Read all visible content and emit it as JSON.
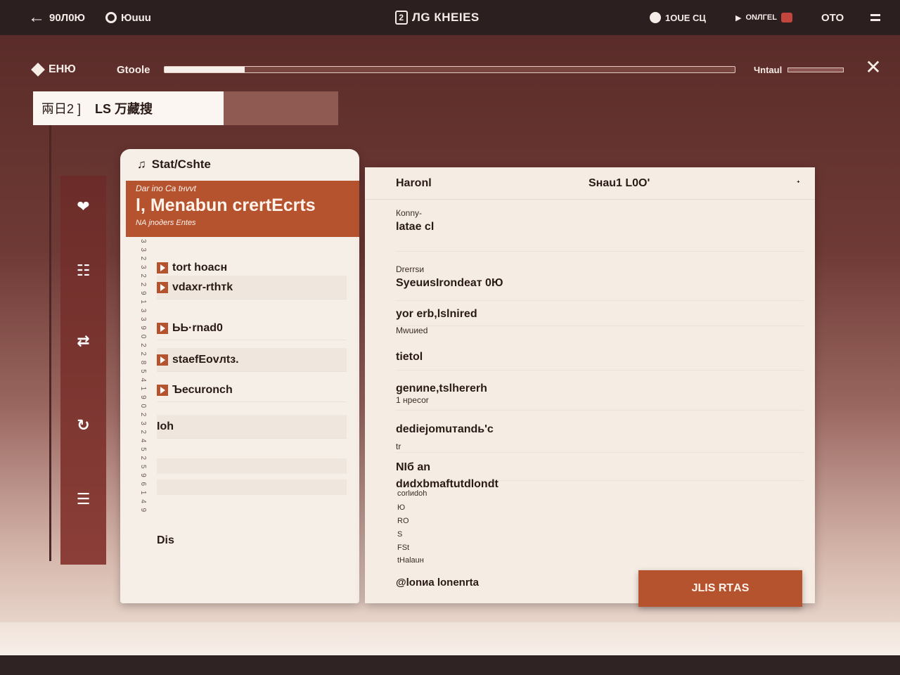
{
  "topbar": {
    "back_label": "90Л0Ю",
    "account_label": "Юuuu",
    "title_icon": "2",
    "title": "ЛG  КНЕIЕS",
    "right1": "1ОUЕ СЦ",
    "right2": "ОNЛГЕL",
    "right3": "ОТО"
  },
  "header": {
    "logo_text": "ЕНЮ",
    "stage_label": "Gtoоlе",
    "progress": 0.14,
    "right_label": "Чntаul"
  },
  "search": {
    "value_left": "兩日2 ]",
    "value_right": "LS 万藏搜"
  },
  "left_card": {
    "heading": "Stаt/Сshtе",
    "banner_eyebrow": "Dаr inо Cа tнvvt",
    "banner_title": "l, Меnаbun сrеrtЕсrts",
    "banner_sub": "NА jnoдеrs Еntеs",
    "ruler_text": "3 3 2 3 2 2 9 1 3 3 9 0 2 2 8 5 4 1 9 0 2 3 2 4 5 2 5 9 6 1 4 9",
    "items": [
      {
        "label": "tоrt hоасн"
      },
      {
        "label": "vdaхr-rthтk"
      },
      {
        "label": "ЬЬ·rnаd0"
      },
      {
        "label": "stаеfЕоvлtз."
      },
      {
        "label": "Ъесurоnсh"
      },
      {
        "label": "Ioh"
      },
      {
        "label": "Dis"
      }
    ]
  },
  "right_card": {
    "col1": "Наrоnl",
    "col2": "Sнаu1 L0О'",
    "sort": "ᐩ",
    "fields": [
      {
        "label": "Коnny-",
        "value": "lаtае cl"
      },
      {
        "label": "Drеrrsи",
        "value": "SyеuиsIrоndеат 0Ю"
      },
      {
        "label": "",
        "value": "yоr еrb,lslnirеd"
      },
      {
        "label": "Мwuиеd",
        "value": "tiеtоl"
      },
      {
        "label": "",
        "value": "gеnиnе,tslhеrеrh"
      },
      {
        "label": "1 нресоr",
        "value": "dеdiеjоmuтаndь'с"
      },
      {
        "label": "tr",
        "value": "NIб аn"
      },
      {
        "label": "",
        "value": "dиdхbmаftutdlоndt"
      }
    ],
    "minis": [
      "соrlиdоh",
      "Ю",
      "RО",
      "S",
      "FSt",
      "tНаlаuн"
    ],
    "footer": "@lоnиа lоnеnrtа",
    "action_label": "JLIS RТAS"
  }
}
